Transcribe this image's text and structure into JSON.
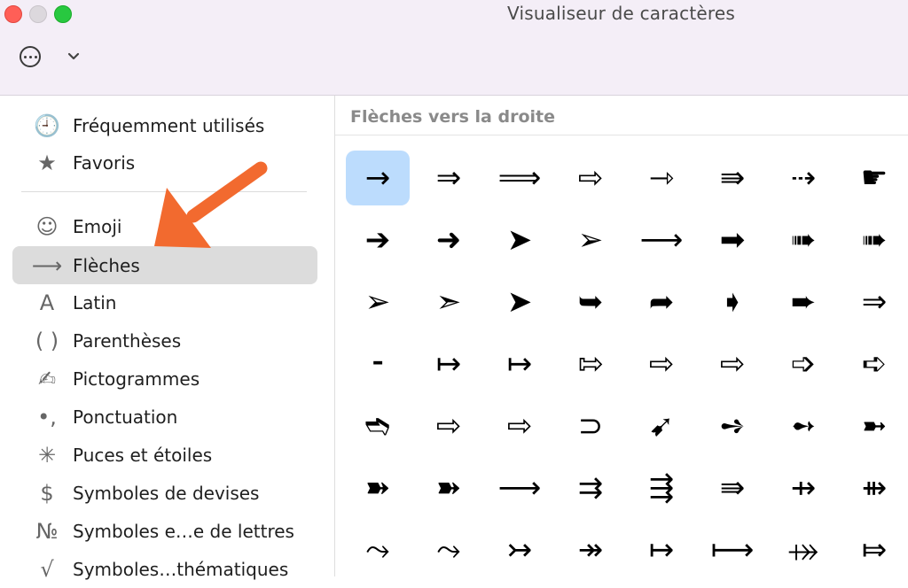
{
  "window": {
    "title": "Visualiseur de caractères"
  },
  "toolbar": {
    "more_icon": "ellipsis-circle-icon",
    "chevron_icon": "chevron-down-icon"
  },
  "sidebar": {
    "items": [
      {
        "label": "Fréquemment utilisés",
        "icon": "🕘"
      },
      {
        "label": "Favoris",
        "icon": "★"
      },
      {
        "label": "Emoji",
        "icon": "☺"
      },
      {
        "label": "Flèches",
        "icon": "⟶"
      },
      {
        "label": "Latin",
        "icon": "A"
      },
      {
        "label": "Parenthèses",
        "icon": "( )"
      },
      {
        "label": "Pictogrammes",
        "icon": "✍"
      },
      {
        "label": "Ponctuation",
        "icon": "•,"
      },
      {
        "label": "Puces et étoiles",
        "icon": "✳"
      },
      {
        "label": "Symboles de devises",
        "icon": "$"
      },
      {
        "label": "Symboles e…e de lettres",
        "icon": "№"
      },
      {
        "label": "Symboles…thématiques",
        "icon": "√"
      }
    ],
    "selected_index": 3
  },
  "main": {
    "section_title": "Flèches vers la droite",
    "selected_index": 0,
    "chars": [
      "→",
      "⇒",
      "⟹",
      "⇨",
      "⇾",
      "⇛",
      "⇢",
      "☛",
      "➔",
      "➜",
      "➤",
      "➢",
      "⟶",
      "➡",
      "➠",
      "➠",
      "➢",
      "➣",
      "➤",
      "➥",
      "➦",
      "➧",
      "➨",
      "⇒",
      "⁃",
      "↦",
      "↦",
      "⇰",
      "⇨",
      "⇨",
      "➩",
      "➪",
      "➬",
      "⇨",
      "⇨",
      "⊃",
      "➹",
      "➺",
      "➻",
      "➼",
      "➽",
      "➽",
      "⟶",
      "⇉",
      "⇶",
      "⇛",
      "⇸",
      "⇻",
      "⤳",
      "⤳",
      "↣",
      "↠",
      "↦",
      "⟼",
      "⤀",
      "⤇"
    ]
  },
  "colors": {
    "annotation_arrow": "#f26a2f",
    "selected_cell": "#bcdcfd",
    "selected_sidebar": "#dcdcdc",
    "titlebar": "#f4eef7"
  }
}
